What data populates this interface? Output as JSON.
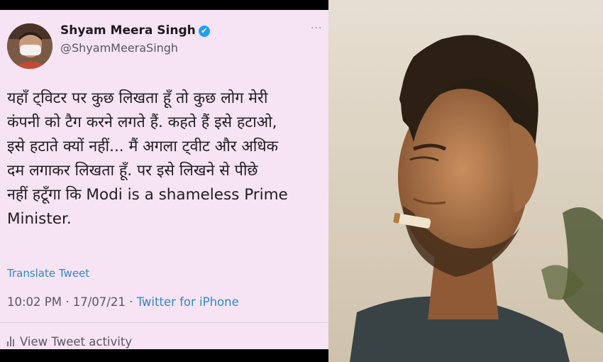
{
  "tweet": {
    "author_name": "Shyam Meera Singh",
    "verified": "✔",
    "author_handle": "@ShyamMeeraSingh",
    "more": "···",
    "lines": [
      "यहाँ ट्विटर पर कुछ लिखता हूँ तो कुछ लोग मेरी",
      "कंपनी को टैग करने लगते हैं. कहते हैं इसे हटाओ,",
      "इसे हटाते क्यों नहीं... मैं अगला ट्वीट और अधिक",
      "दम लगाकर लिखता हूँ. पर इसे लिखने से पीछे",
      "नहीं हटूँगा कि Modi is a shameless Prime",
      "Minister."
    ],
    "translate": "Translate Tweet",
    "time": "10:02 PM · 17/07/21 · ",
    "source": "Twitter for iPhone",
    "activity": "View Tweet activity"
  },
  "colors": {
    "tweet_bg": "#f6e4f4",
    "link": "#2b89c6",
    "verified": "#1da1f2"
  },
  "icons": [
    "verified-icon",
    "more-icon",
    "analytics-bar-icon"
  ]
}
